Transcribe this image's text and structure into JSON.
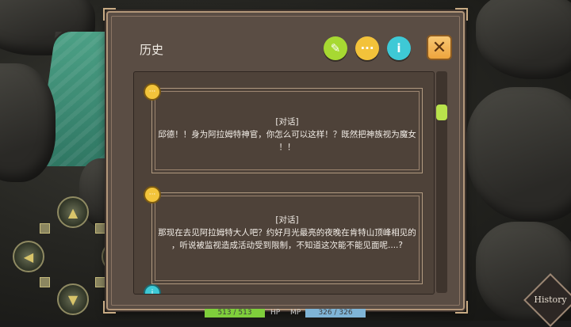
{
  "panel": {
    "title": "历史",
    "icons": [
      {
        "name": "auto-icon",
        "glyph": "✎",
        "color": "#a7d932"
      },
      {
        "name": "chat-icon",
        "glyph": "···",
        "color": "#f3c23a"
      },
      {
        "name": "info-icon",
        "glyph": "i",
        "color": "#3ec9d6"
      }
    ],
    "close_glyph": "✕"
  },
  "entries": [
    {
      "tag": "[对话]",
      "line1": "邱德！！身为阿拉姆特神官，你怎么可以这样！？既然把神族视为魔女",
      "line2": "！！"
    },
    {
      "tag": "[对话]",
      "line1": "那现在去见阿拉姆特大人吧？约好月光最亮的夜晚在肯特山顶峰相见的",
      "line2": "，听说被监视造成活动受到限制，不知道这次能不能见面呢....?"
    }
  ],
  "status": {
    "hp_value": "513 / 513",
    "hp_label": "HP",
    "mp_label": "MP",
    "mp_value": "326 / 326"
  },
  "history_button": "History",
  "colors": {
    "hp": "#7fce3b",
    "mp": "#7fb4d6",
    "accent": "#f2c43b"
  }
}
